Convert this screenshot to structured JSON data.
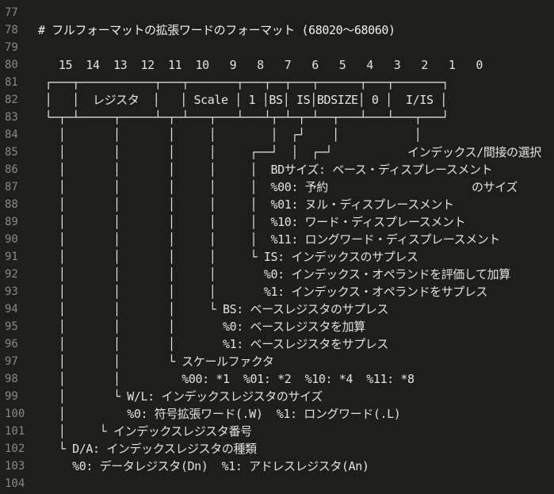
{
  "editor": {
    "lines": [
      {
        "number": "77",
        "text": ""
      },
      {
        "number": "78",
        "text": "# フルフォーマットの拡張ワードのフォーマット (68020〜68060)"
      },
      {
        "number": "79",
        "text": ""
      },
      {
        "number": "80",
        "text": "   15  14  13  12  11  10   9   8   7   6   5   4   3   2   1   0"
      },
      {
        "number": "81",
        "text": " ┌───┬───────────┬───┬───────┬───┬──┬───┬──────┬───┬───────┐"
      },
      {
        "number": "82",
        "text": " │   │  レジスタ  │   │ Scale │ 1 │BS│ IS│BDSIZE│ 0 │  I/IS │"
      },
      {
        "number": "83",
        "text": " └─┬─┴─────┬─────┴─┬─┴───┬───┴───┴┬─┴─┬─┴──┬───┴───┴───┬───┘"
      },
      {
        "number": "84",
        "text": "   │       │       │     │        │  ┌┘    │           │"
      },
      {
        "number": "85",
        "text": "   │       │       │     │     ┌──┘  │  ┌─┘           インデックス/間接の選択"
      },
      {
        "number": "86",
        "text": "   │       │       │     │     │  BDサイズ: ベース・ディスプレースメント"
      },
      {
        "number": "87",
        "text": "   │       │       │     │     │  %00: 予約                     のサイズ"
      },
      {
        "number": "88",
        "text": "   │       │       │     │     │  %01: ヌル・ディスプレースメント"
      },
      {
        "number": "89",
        "text": "   │       │       │     │     │  %10: ワード・ディスプレースメント"
      },
      {
        "number": "90",
        "text": "   │       │       │     │     │  %11: ロングワード・ディスプレースメント"
      },
      {
        "number": "91",
        "text": "   │       │       │     │     └ IS: インデックスのサプレス"
      },
      {
        "number": "92",
        "text": "   │       │       │     │       %0: インデックス・オペランドを評価して加算"
      },
      {
        "number": "93",
        "text": "   │       │       │     │       %1: インデックス・オペランドをサプレス"
      },
      {
        "number": "94",
        "text": "   │       │       │     └ BS: ベースレジスタのサプレス"
      },
      {
        "number": "95",
        "text": "   │       │       │       %0: ベースレジスタを加算"
      },
      {
        "number": "96",
        "text": "   │       │       │       %1: ベースレジスタをサプレス"
      },
      {
        "number": "97",
        "text": "   │       │       └ スケールファクタ"
      },
      {
        "number": "98",
        "text": "   │       │         %00: *1  %01: *2  %10: *4  %11: *8"
      },
      {
        "number": "99",
        "text": "   │       └ W/L: インデックスレジスタのサイズ"
      },
      {
        "number": "100",
        "text": "   │         %0: 符号拡張ワード(.W)  %1: ロングワード(.L)"
      },
      {
        "number": "101",
        "text": "   │     └ インデックスレジスタ番号"
      },
      {
        "number": "102",
        "text": "   └ D/A: インデックスレジスタの種類"
      },
      {
        "number": "103",
        "text": "     %0: データレジスタ(Dn)  %1: アドレスレジスタ(An)"
      },
      {
        "number": "104",
        "text": ""
      }
    ]
  },
  "colors": {
    "background": "#1e1f1c",
    "text": "#e2e2dc",
    "line_number": "#8a8a80"
  }
}
